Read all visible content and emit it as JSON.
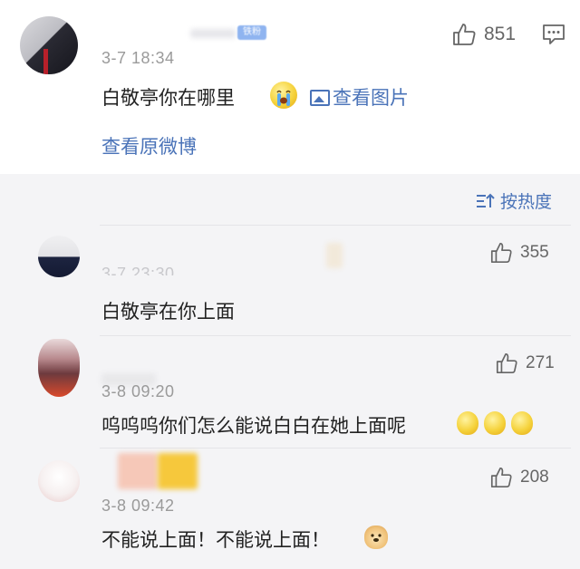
{
  "root_comment": {
    "fan_badge": "铁粉",
    "timestamp": "3-7 18:34",
    "text": "白敬亭你在哪里",
    "emoji": "crying-face-icon",
    "view_image_label": "查看图片",
    "view_original_label": "查看原微博",
    "likes": "851"
  },
  "sort": {
    "label": "按热度"
  },
  "replies": [
    {
      "timestamp": "3-7 23:30",
      "text": "白敬亭在你上面",
      "likes": "355"
    },
    {
      "timestamp": "3-8 09:20",
      "text": "呜呜呜你们怎么能说白白在她上面呢",
      "likes": "271",
      "emojis": [
        "lemon-face-icon",
        "lemon-face-icon",
        "lemon-face-icon"
      ]
    },
    {
      "timestamp": "3-8 09:42",
      "text": "不能说上面！不能说上面！",
      "likes": "208",
      "emojis": [
        "doge-icon"
      ]
    }
  ],
  "colors": {
    "link": "#4a73b8",
    "muted": "#9a9a9a",
    "background": "#f4f4f6"
  }
}
